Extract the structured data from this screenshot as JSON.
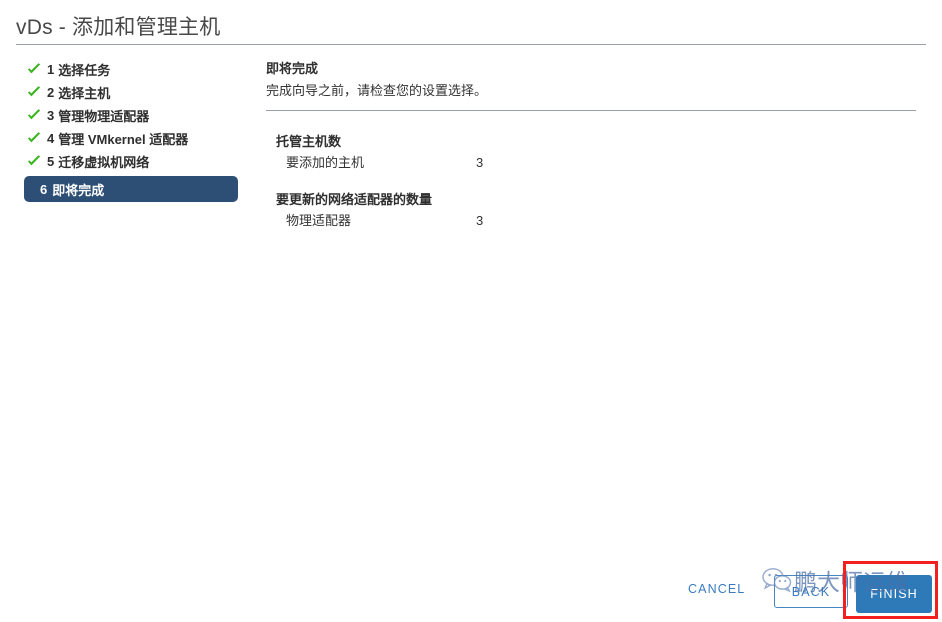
{
  "header": {
    "title": "vDs - 添加和管理主机"
  },
  "steps": [
    {
      "num": "1",
      "label": "选择任务",
      "state": "completed",
      "icon": "check-icon"
    },
    {
      "num": "2",
      "label": "选择主机",
      "state": "completed",
      "icon": "check-icon"
    },
    {
      "num": "3",
      "label": "管理物理适配器",
      "state": "completed",
      "icon": "check-icon"
    },
    {
      "num": "4",
      "label": "管理 VMkernel 适配器",
      "state": "completed",
      "icon": "check-icon"
    },
    {
      "num": "5",
      "label": "迁移虚拟机网络",
      "state": "completed",
      "icon": "check-icon"
    },
    {
      "num": "6",
      "label": "即将完成",
      "state": "active",
      "icon": ""
    }
  ],
  "content": {
    "title": "即将完成",
    "subtitle": "完成向导之前，请检查您的设置选择。",
    "groups": [
      {
        "title": "托管主机数",
        "rows": [
          {
            "label": "要添加的主机",
            "value": "3"
          }
        ]
      },
      {
        "title": "要更新的网络适配器的数量",
        "rows": [
          {
            "label": "物理适配器",
            "value": "3"
          }
        ]
      }
    ]
  },
  "footer": {
    "cancel_label": "CANCEL",
    "back_label": "BACK",
    "finish_label": "FINISH"
  },
  "watermark": {
    "text": "鹏大师运维",
    "icon": "wechat-icon"
  },
  "colors": {
    "active_step_bg": "#2d4f76",
    "check_green": "#3cb521",
    "primary_blue": "#2e7ab8",
    "link_blue": "#3a7bbf",
    "annotation_red": "#f42020",
    "divider_gray": "#9aa0a6",
    "watermark_blue": "#4a6fa8"
  }
}
